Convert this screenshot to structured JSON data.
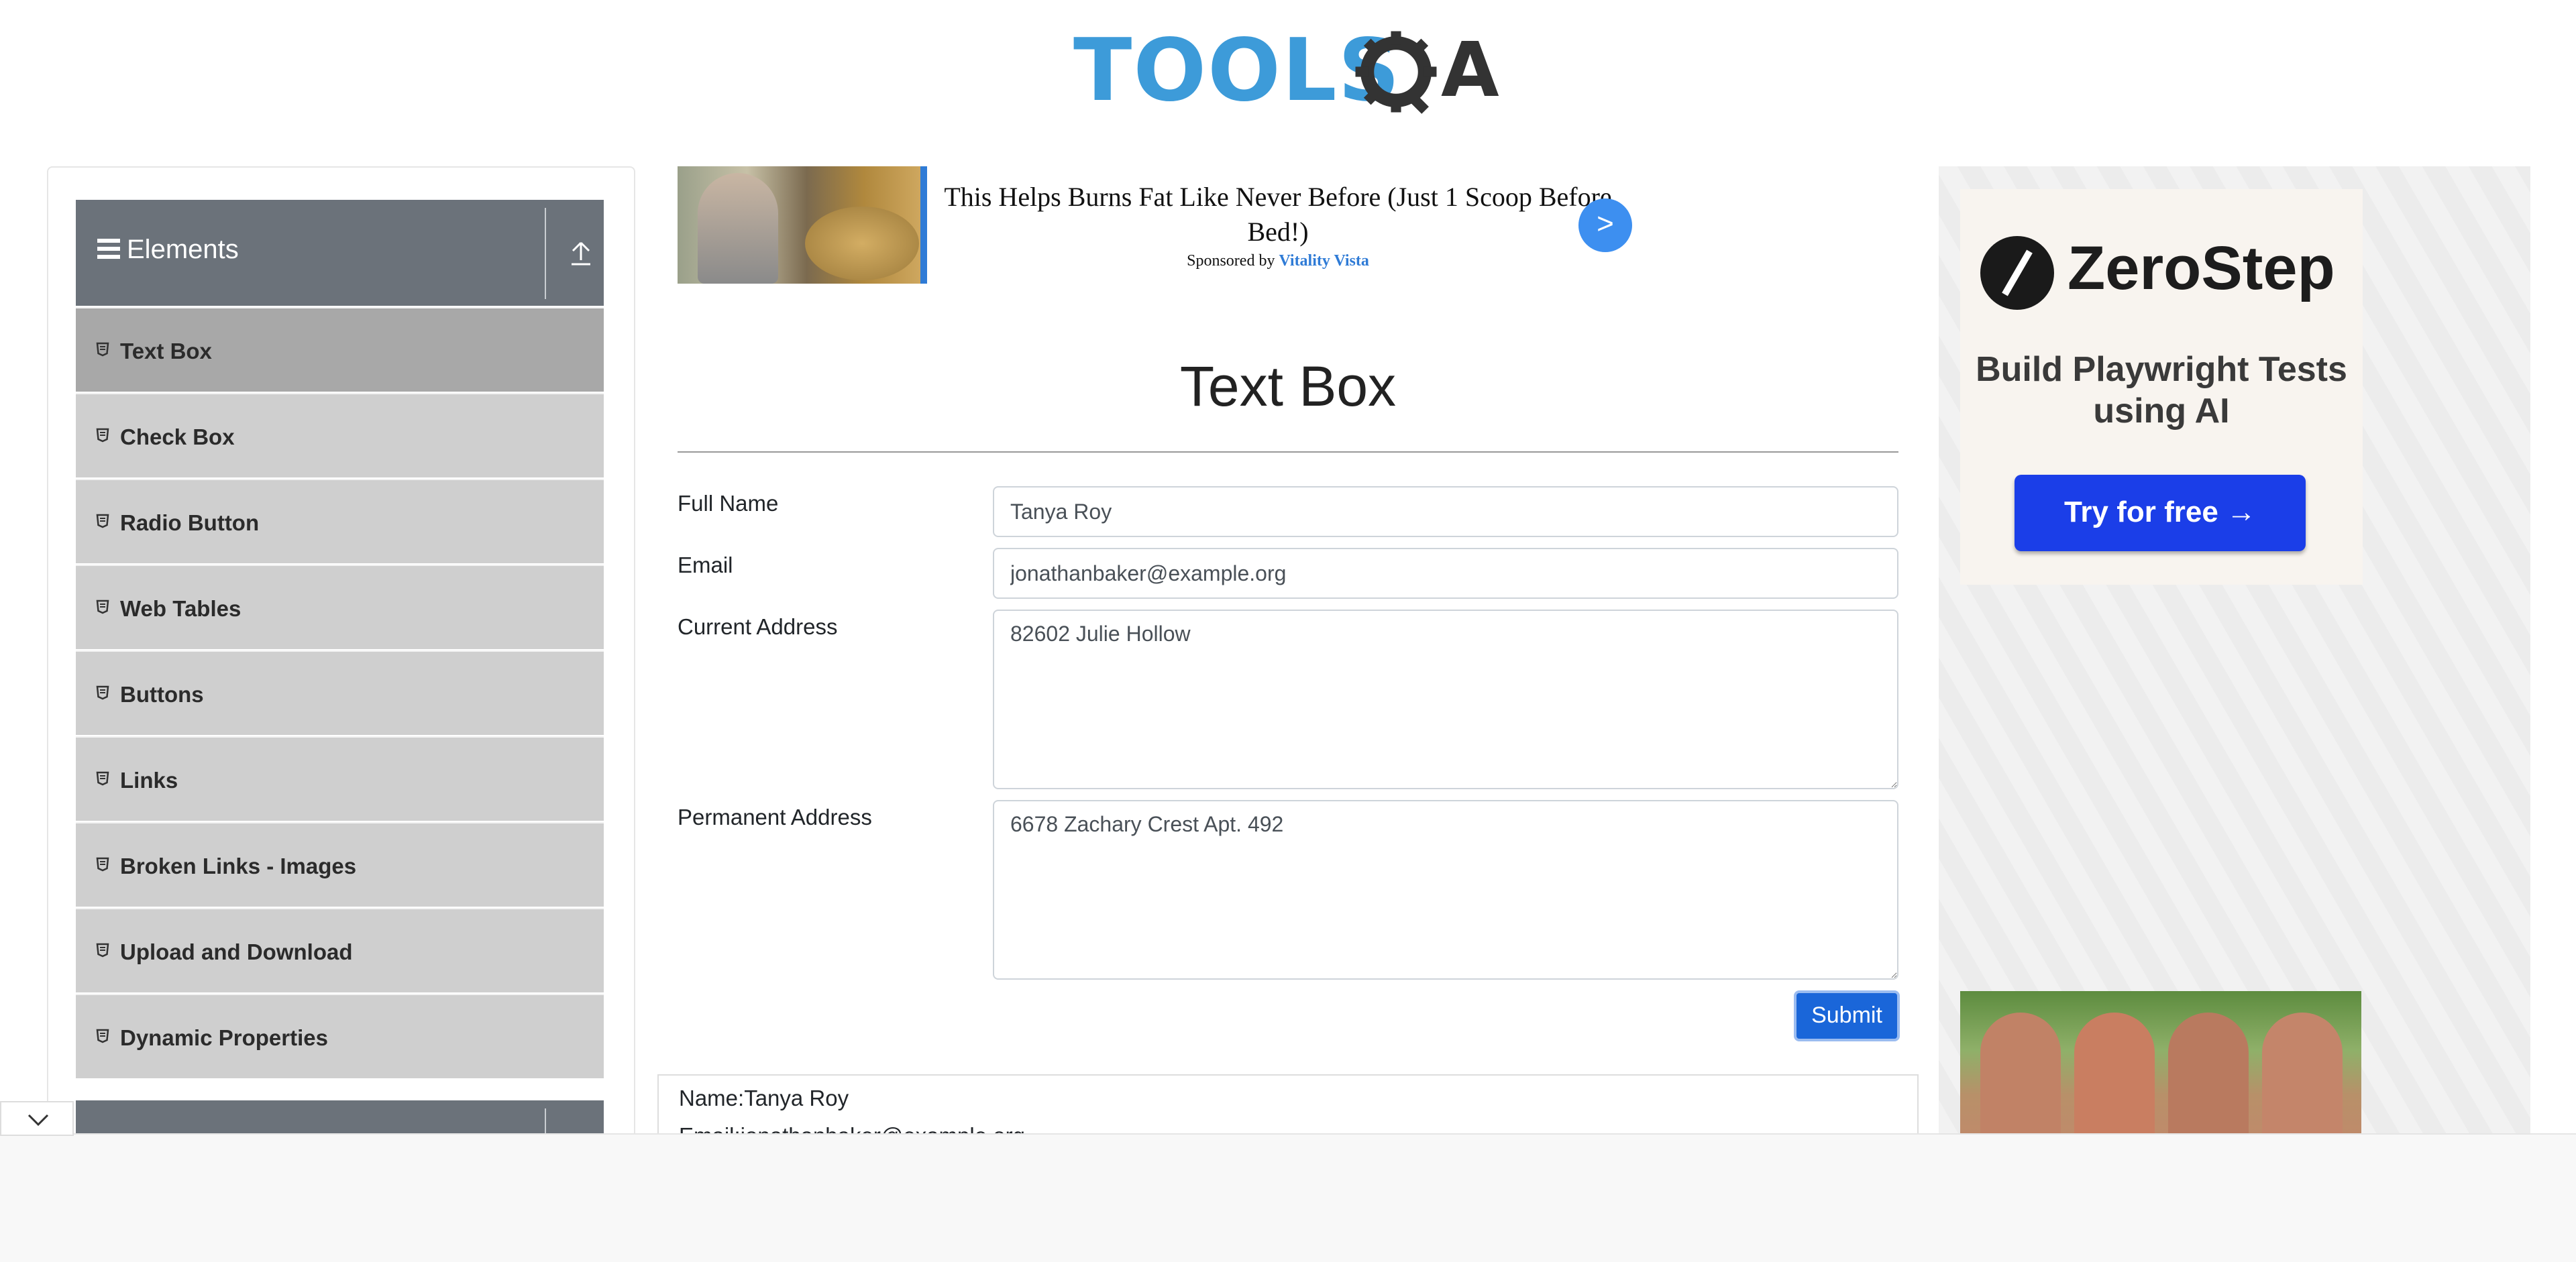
{
  "header": {
    "logo_primary": "TOOLS",
    "logo_secondary": "QA"
  },
  "sidebar": {
    "group_title": "Elements",
    "items": [
      {
        "label": "Text Box",
        "active": true
      },
      {
        "label": "Check Box"
      },
      {
        "label": "Radio Button"
      },
      {
        "label": "Web Tables"
      },
      {
        "label": "Buttons"
      },
      {
        "label": "Links"
      },
      {
        "label": "Broken Links - Images"
      },
      {
        "label": "Upload and Download"
      },
      {
        "label": "Dynamic Properties"
      }
    ]
  },
  "ad_banner": {
    "headline": "This Helps Burns Fat Like Never Before (Just 1 Scoop Before Bed!)",
    "sponsored_prefix": "Sponsored by",
    "sponsor": "Vitality Vista",
    "arrow": ">"
  },
  "main": {
    "title": "Text Box",
    "form": {
      "full_name_label": "Full Name",
      "full_name_value": "Tanya Roy",
      "email_label": "Email",
      "email_value": "jonathanbaker@example.org",
      "current_address_label": "Current Address",
      "current_address_value": "82602 Julie Hollow",
      "permanent_address_label": "Permanent Address",
      "permanent_address_value": "6678 Zachary Crest Apt. 492",
      "submit_label": "Submit"
    },
    "output": {
      "name_line": "Name:Tanya Roy",
      "email_line": "Email:jonathanbaker@example.org"
    }
  },
  "right_ad": {
    "brand": "ZeroStep",
    "tagline": "Build Playwright Tests using AI",
    "cta": "Try for free →"
  },
  "colors": {
    "sidebar_header": "#6b727a",
    "menu_item": "#cfcfcf",
    "menu_item_active": "#a8a8a8",
    "submit_button": "#1a66d9",
    "logo_blue": "#3d9bd9",
    "cta_blue": "#1b3ee8"
  },
  "icons": {
    "menu": "hamburger-icon",
    "collapse": "upload-arrow-icon",
    "item": "shield-icon",
    "bottom": "chevron-down-icon"
  }
}
